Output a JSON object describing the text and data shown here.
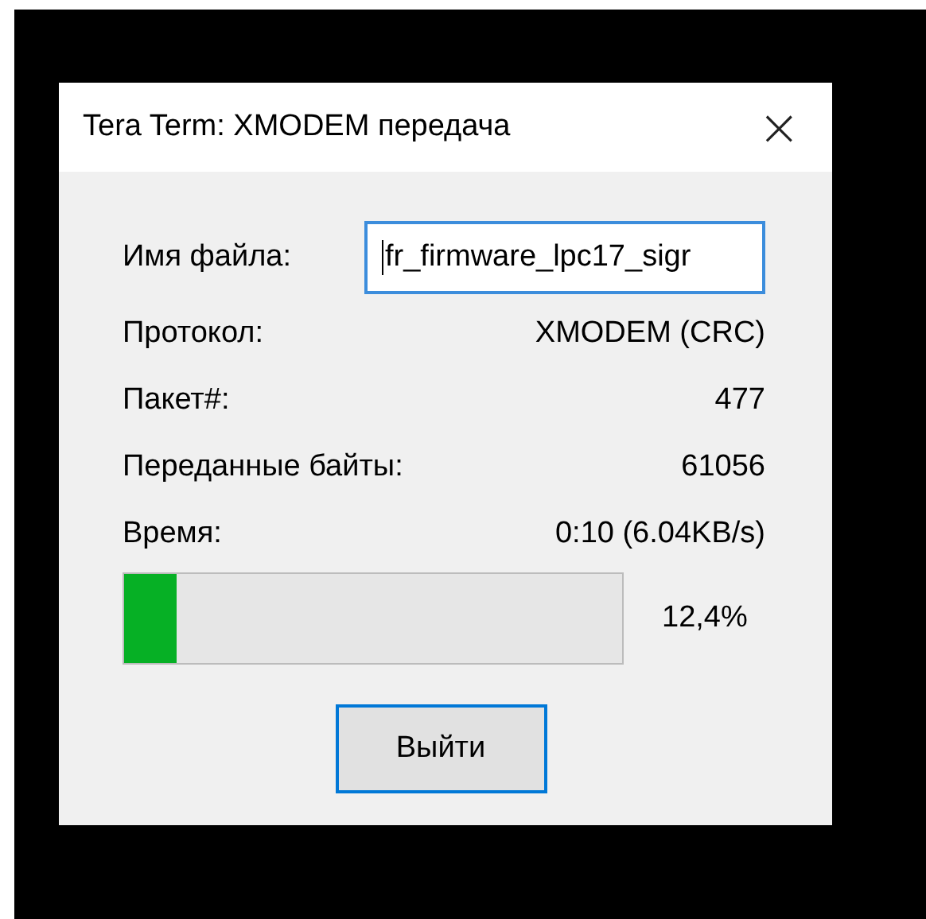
{
  "window": {
    "title": "Tera Term: XMODEM передача",
    "close": "×"
  },
  "file_field": {
    "label": "Имя файла:",
    "value": "fr_firmware_lpc17_sigr"
  },
  "info": [
    {
      "label": "Протокол:",
      "value": "XMODEM (CRC)"
    },
    {
      "label": "Пакет#:",
      "value": "477"
    },
    {
      "label": "Переданные байты:",
      "value": "61056"
    },
    {
      "label": "Время:",
      "value": "0:10 (6.04KB/s)"
    }
  ],
  "progress": {
    "level": 0.105,
    "reading": "12,4%"
  },
  "buttons": [
    {
      "label": "Выйти",
      "focused": true
    }
  ]
}
